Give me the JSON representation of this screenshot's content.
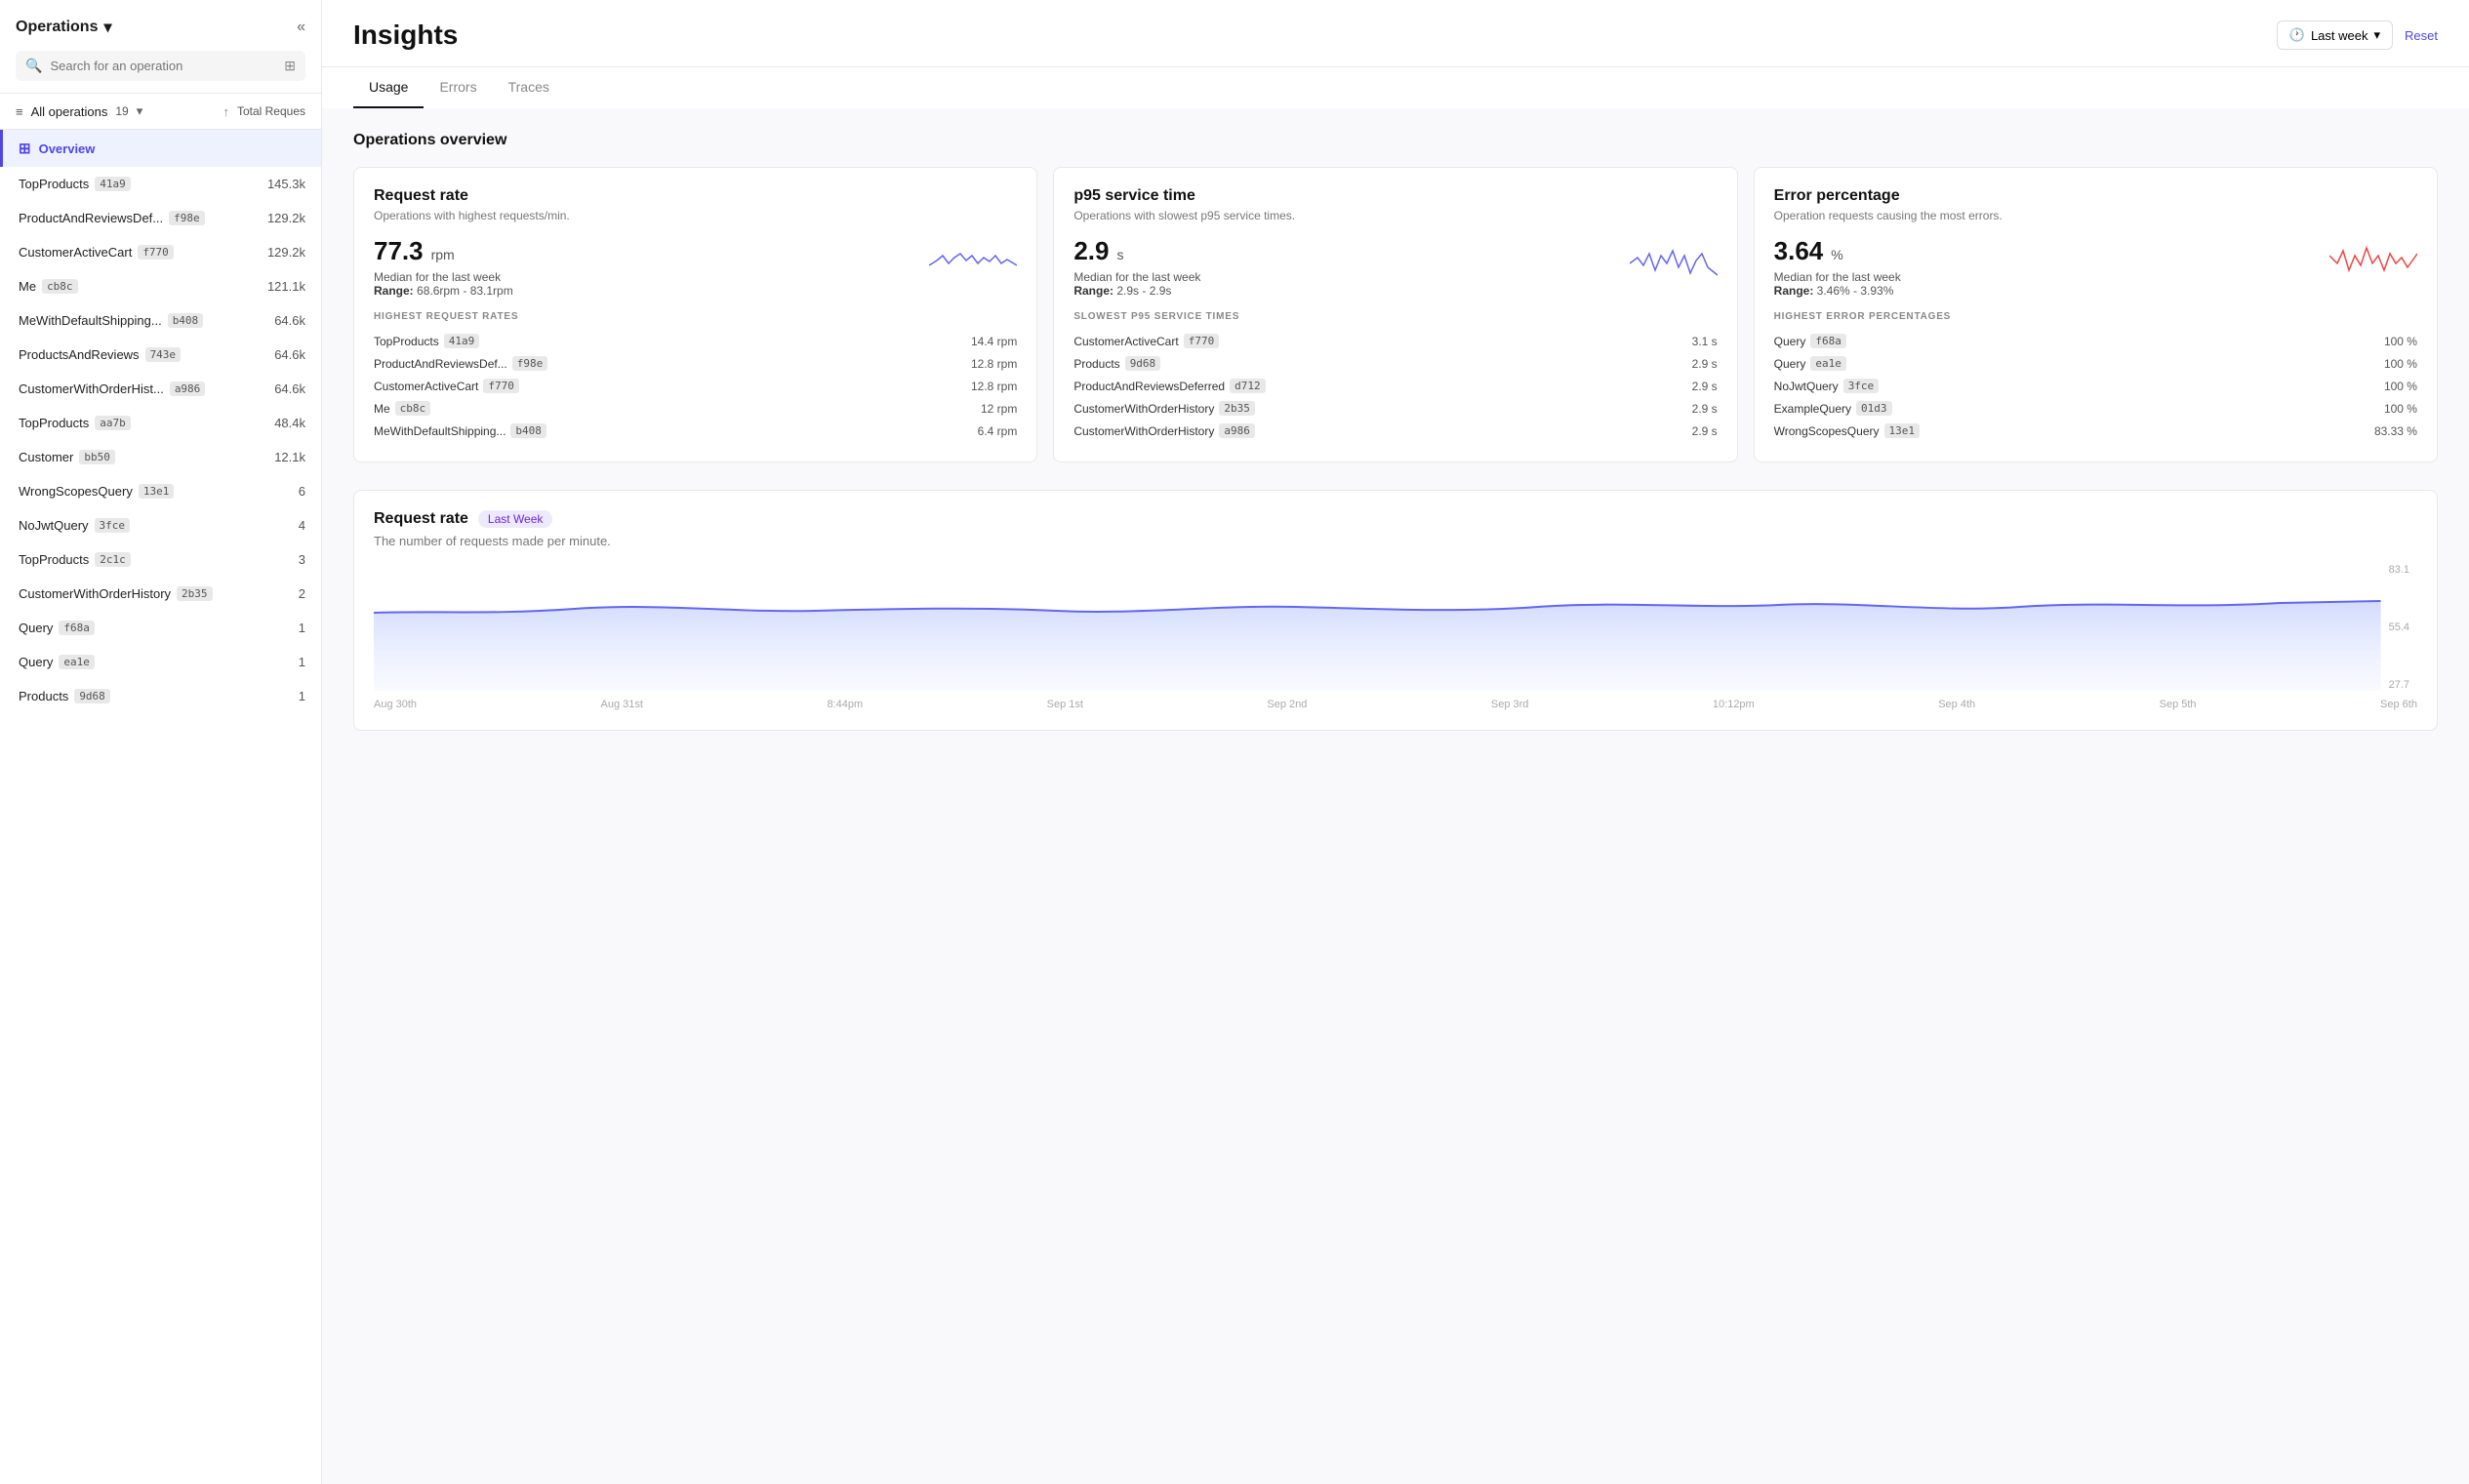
{
  "sidebar": {
    "title": "Operations",
    "collapse_icon": "«",
    "search_placeholder": "Search for an operation",
    "filter_label": "All operations",
    "ops_count": "19",
    "sort_icon": "↑",
    "total_requests_label": "Total Reques",
    "overview_label": "Overview",
    "operations": [
      {
        "name": "TopProducts",
        "hash": "41a9",
        "count": "145.3k"
      },
      {
        "name": "ProductAndReviewsDef...",
        "hash": "f98e",
        "count": "129.2k"
      },
      {
        "name": "CustomerActiveCart",
        "hash": "f770",
        "count": "129.2k"
      },
      {
        "name": "Me",
        "hash": "cb8c",
        "count": "121.1k"
      },
      {
        "name": "MeWithDefaultShipping...",
        "hash": "b408",
        "count": "64.6k"
      },
      {
        "name": "ProductsAndReviews",
        "hash": "743e",
        "count": "64.6k"
      },
      {
        "name": "CustomerWithOrderHist...",
        "hash": "a986",
        "count": "64.6k"
      },
      {
        "name": "TopProducts",
        "hash": "aa7b",
        "count": "48.4k"
      },
      {
        "name": "Customer",
        "hash": "bb50",
        "count": "12.1k"
      },
      {
        "name": "WrongScopesQuery",
        "hash": "13e1",
        "count": "6"
      },
      {
        "name": "NoJwtQuery",
        "hash": "3fce",
        "count": "4"
      },
      {
        "name": "TopProducts",
        "hash": "2c1c",
        "count": "3"
      },
      {
        "name": "CustomerWithOrderHistory",
        "hash": "2b35",
        "count": "2"
      },
      {
        "name": "Query",
        "hash": "f68a",
        "count": "1"
      },
      {
        "name": "Query",
        "hash": "ea1e",
        "count": "1"
      },
      {
        "name": "Products",
        "hash": "9d68",
        "count": "1"
      }
    ]
  },
  "header": {
    "title": "Insights",
    "time_selector": "Last week",
    "reset_label": "Reset"
  },
  "tabs": [
    {
      "label": "Usage",
      "active": true
    },
    {
      "label": "Errors",
      "active": false
    },
    {
      "label": "Traces",
      "active": false
    }
  ],
  "ops_overview_title": "Operations overview",
  "cards": {
    "request_rate": {
      "title": "Request rate",
      "desc": "Operations with highest requests/min.",
      "value": "77.3",
      "unit": "rpm",
      "median_label": "Median for the last week",
      "range_label": "Range:",
      "range_value": "68.6rpm - 83.1rpm",
      "table_title": "HIGHEST REQUEST RATES",
      "rows": [
        {
          "name": "TopProducts",
          "hash": "41a9",
          "value": "14.4 rpm"
        },
        {
          "name": "ProductAndReviewsDef...",
          "hash": "f98e",
          "value": "12.8 rpm"
        },
        {
          "name": "CustomerActiveCart",
          "hash": "f770",
          "value": "12.8 rpm"
        },
        {
          "name": "Me",
          "hash": "cb8c",
          "value": "12 rpm"
        },
        {
          "name": "MeWithDefaultShipping...",
          "hash": "b408",
          "value": "6.4 rpm"
        }
      ]
    },
    "p95_service_time": {
      "title": "p95 service time",
      "desc": "Operations with slowest p95 service times.",
      "value": "2.9",
      "unit": "s",
      "median_label": "Median for the last week",
      "range_label": "Range:",
      "range_value": "2.9s - 2.9s",
      "table_title": "SLOWEST P95 SERVICE TIMES",
      "rows": [
        {
          "name": "CustomerActiveCart",
          "hash": "f770",
          "value": "3.1 s"
        },
        {
          "name": "Products",
          "hash": "9d68",
          "value": "2.9 s"
        },
        {
          "name": "ProductAndReviewsDeferred",
          "hash": "d712",
          "value": "2.9 s"
        },
        {
          "name": "CustomerWithOrderHistory",
          "hash": "2b35",
          "value": "2.9 s"
        },
        {
          "name": "CustomerWithOrderHistory",
          "hash": "a986",
          "value": "2.9 s"
        }
      ]
    },
    "error_percentage": {
      "title": "Error percentage",
      "desc": "Operation requests causing the most errors.",
      "value": "3.64",
      "unit": "%",
      "median_label": "Median for the last week",
      "range_label": "Range:",
      "range_value": "3.46% - 3.93%",
      "table_title": "HIGHEST ERROR PERCENTAGES",
      "rows": [
        {
          "name": "Query",
          "hash": "f68a",
          "value": "100 %"
        },
        {
          "name": "Query",
          "hash": "ea1e",
          "value": "100 %"
        },
        {
          "name": "NoJwtQuery",
          "hash": "3fce",
          "value": "100 %"
        },
        {
          "name": "ExampleQuery",
          "hash": "01d3",
          "value": "100 %"
        },
        {
          "name": "WrongScopesQuery",
          "hash": "13e1",
          "value": "83.33 %"
        }
      ]
    }
  },
  "request_rate_chart": {
    "title": "Request rate",
    "badge": "Last Week",
    "desc": "The number of requests made per minute.",
    "y_labels": [
      "83.1",
      "55.4",
      "27.7"
    ],
    "x_labels": [
      "Aug 30th",
      "Aug 31st",
      "8:44pm",
      "Sep 1st",
      "Sep 2nd",
      "Sep 3rd",
      "10:12pm",
      "Sep 4th",
      "Sep 5th",
      "Sep 6th"
    ]
  }
}
